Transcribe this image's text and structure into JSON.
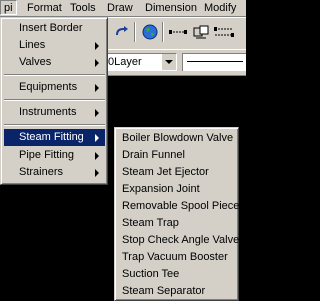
{
  "menubar": {
    "items": [
      "pi",
      "Format",
      "Tools",
      "Draw",
      "Dimension",
      "Modify"
    ]
  },
  "toolbar": {
    "layer_value": "0Layer"
  },
  "main_menu": {
    "items": [
      {
        "label": "Insert Border",
        "submenu": false
      },
      {
        "label": "Lines",
        "submenu": true
      },
      {
        "label": "Valves",
        "submenu": true
      },
      {
        "label": "Equipments",
        "submenu": true
      },
      {
        "label": "Instruments",
        "submenu": true
      },
      {
        "label": "Steam Fitting",
        "submenu": true,
        "highlighted": true
      },
      {
        "label": "Pipe Fitting",
        "submenu": true
      },
      {
        "label": "Strainers",
        "submenu": true
      }
    ]
  },
  "sub_menu": {
    "items": [
      "Boiler Blowdown Valve",
      "Drain Funnel",
      "Steam Jet Ejector",
      "Expansion Joint",
      "Removable Spool Piece",
      "Steam Trap",
      "Stop Check Angle Valve",
      "Trap Vacuum Booster",
      "Suction Tee",
      "Steam Separator"
    ]
  },
  "colors": {
    "menu_bg": "#d4d0c8",
    "highlight": "#0a246a",
    "canvas": "#000000"
  }
}
